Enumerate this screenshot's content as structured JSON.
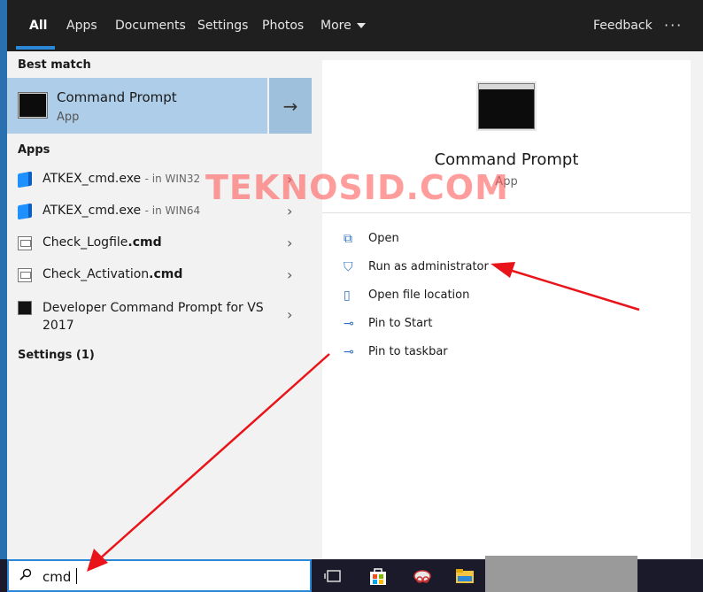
{
  "tabs": [
    {
      "label": "All",
      "active": true
    },
    {
      "label": "Apps"
    },
    {
      "label": "Documents"
    },
    {
      "label": "Settings"
    },
    {
      "label": "Photos"
    },
    {
      "label": "More"
    }
  ],
  "header": {
    "feedback": "Feedback",
    "more_options": "···"
  },
  "best_match": {
    "section": "Best match",
    "title": "Command Prompt",
    "subtitle": "App",
    "icon": "command-prompt-icon"
  },
  "apps": {
    "section": "Apps",
    "items": [
      {
        "name": "ATKEX_cmd.exe",
        "location": "- in WIN32",
        "icon": "cube-icon"
      },
      {
        "name": "ATKEX_cmd.exe",
        "location": "- in WIN64",
        "icon": "cube-icon"
      },
      {
        "name_plain": "Check_Logfile",
        "name_bold": ".cmd",
        "icon": "script-icon"
      },
      {
        "name_plain": "Check_Activation",
        "name_bold": ".cmd",
        "icon": "script-icon"
      },
      {
        "name_line1": "Developer Command Prompt for VS",
        "name_line2": "2017",
        "icon": "terminal-icon"
      }
    ]
  },
  "settings_section": "Settings (1)",
  "details": {
    "title": "Command Prompt",
    "subtitle": "App",
    "actions": [
      {
        "label": "Open",
        "icon": "open-icon"
      },
      {
        "label": "Run as administrator",
        "icon": "shield-icon"
      },
      {
        "label": "Open file location",
        "icon": "folder-location-icon"
      },
      {
        "label": "Pin to Start",
        "icon": "pin-icon"
      },
      {
        "label": "Pin to taskbar",
        "icon": "pin-icon"
      }
    ]
  },
  "watermark": "TEKNOSID.COM",
  "search": {
    "value": "cmd"
  },
  "colors": {
    "accent": "#2b88d8",
    "selected": "#aecde8",
    "annotation": "#e8141a"
  }
}
